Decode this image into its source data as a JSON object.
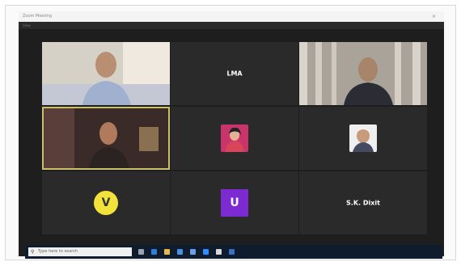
{
  "window": {
    "title": "Zoom Meeting",
    "close_glyph": "×",
    "subbar_text": "View"
  },
  "participants": [
    {
      "name": "",
      "tile_type": "video",
      "label": ""
    },
    {
      "name": "LMA",
      "tile_type": "name",
      "label": ""
    },
    {
      "name": "",
      "tile_type": "video",
      "label": ""
    },
    {
      "name": "",
      "tile_type": "video",
      "label": "",
      "active_speaker": true
    },
    {
      "name": "",
      "tile_type": "thumbnail",
      "label": ""
    },
    {
      "name": "",
      "tile_type": "thumbnail",
      "label": ""
    },
    {
      "name": "",
      "tile_type": "avatar-circle",
      "avatar_text": "V",
      "label": ""
    },
    {
      "name": "",
      "tile_type": "avatar-square",
      "avatar_text": "U",
      "label": ""
    },
    {
      "name": "S.K. Dixit",
      "tile_type": "name",
      "label": ""
    }
  ],
  "taskbar": {
    "search_placeholder": "Type here to search",
    "icons": [
      "task-view-icon",
      "edge-icon",
      "file-explorer-icon",
      "store-icon",
      "mail-icon",
      "zoom-icon",
      "chrome-icon",
      "word-icon"
    ],
    "clock_time": "",
    "clock_date": ""
  },
  "colors": {
    "active_speaker_border": "#c9c06a",
    "avatar_yellow": "#f2e33a",
    "avatar_purple": "#7b2bd1"
  }
}
